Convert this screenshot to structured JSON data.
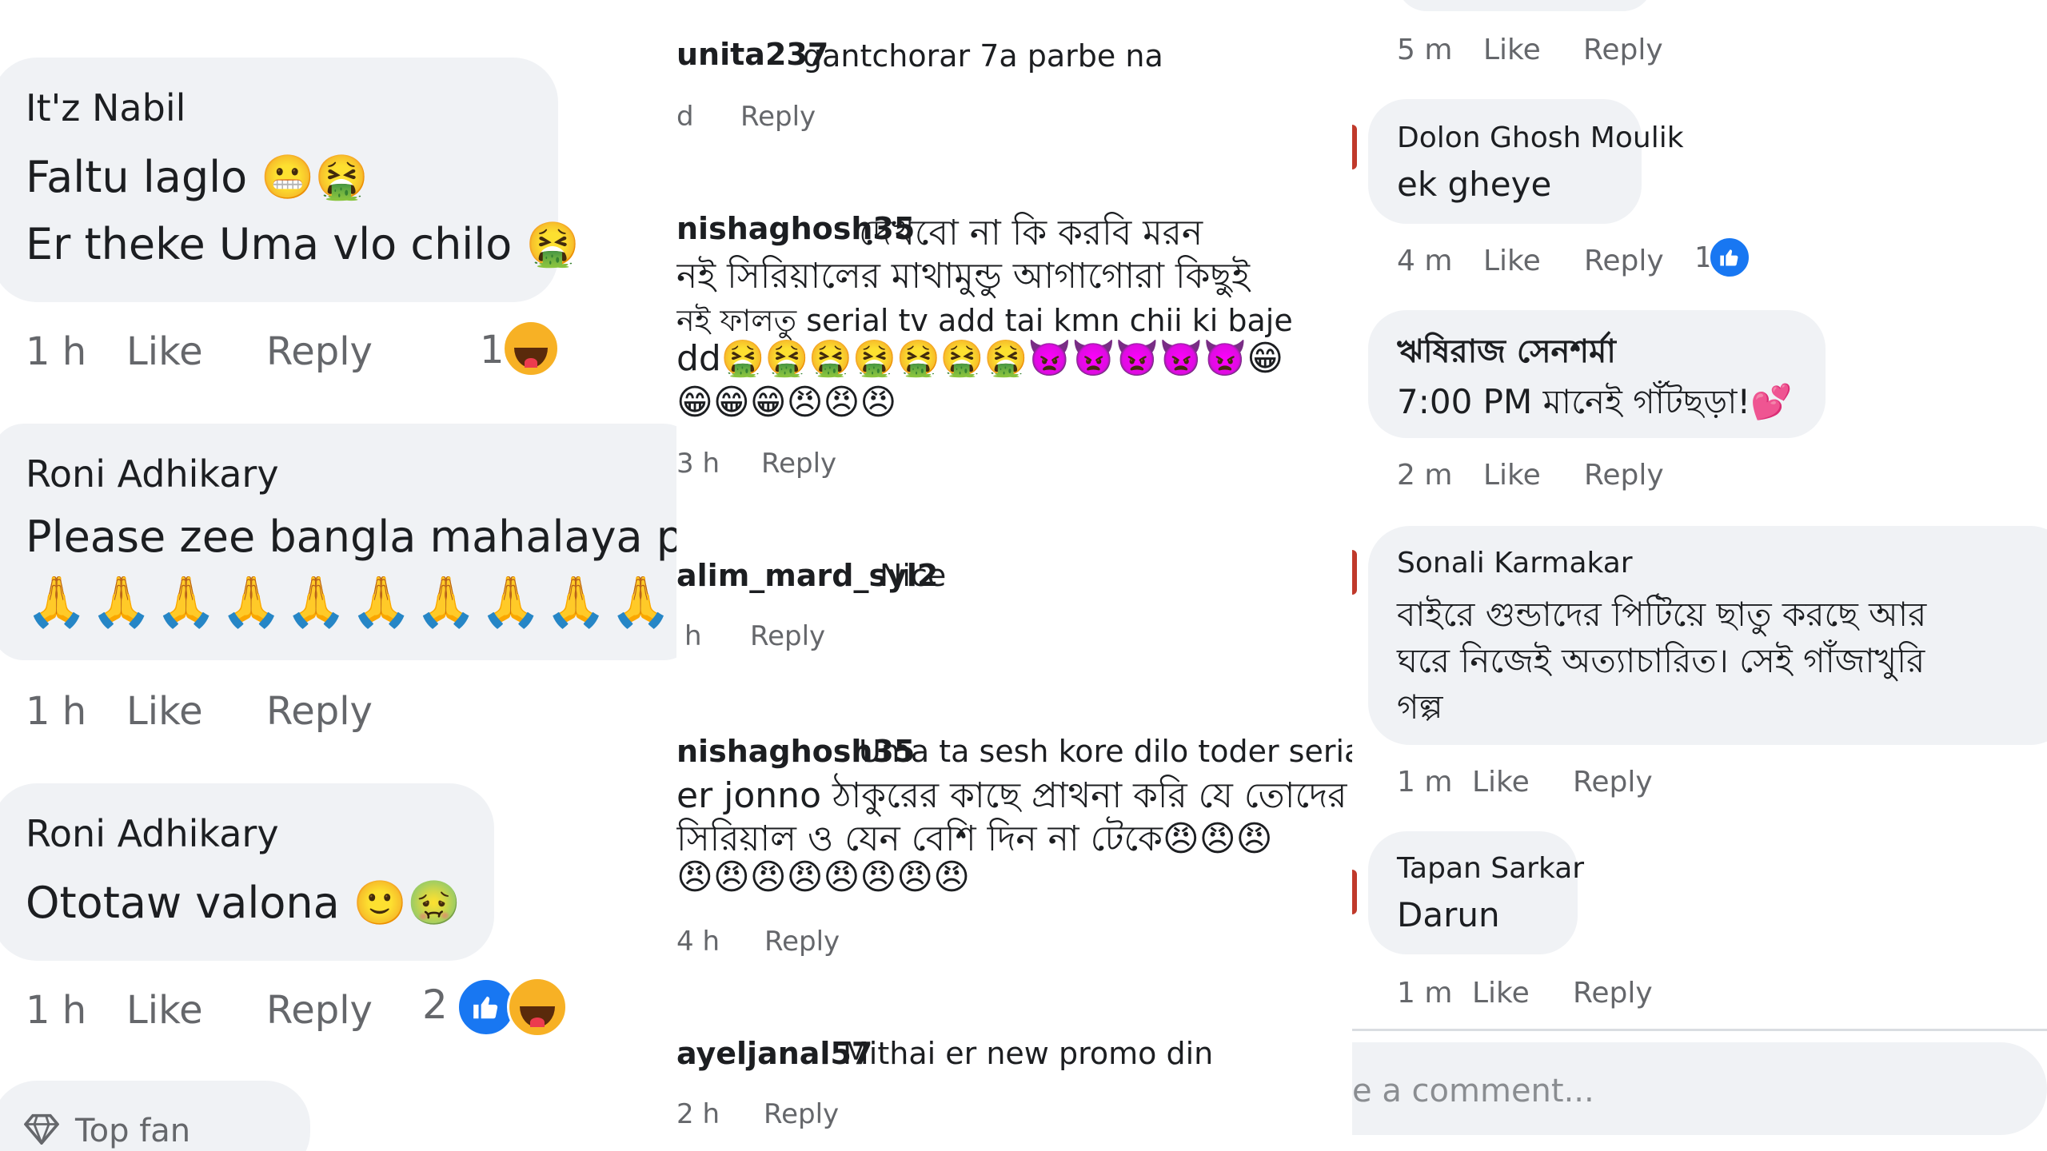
{
  "left": {
    "comments": [
      {
        "author": "It'z Nabil",
        "line1": "Faltu laglo 😬🤮",
        "line2": "Er theke Uma vlo chilo 🤮",
        "time": "1 h",
        "like": "Like",
        "reply": "Reply",
        "reaction_count": "1"
      },
      {
        "author": "Roni Adhikary",
        "line1": "Please zee bangla mahalaya promo",
        "line2": "🙏🙏🙏🙏🙏🙏🙏🙏🙏🙏",
        "time": "1 h",
        "like": "Like",
        "reply": "Reply"
      },
      {
        "author": "Roni Adhikary",
        "line1": "Ototaw valona 🙂🤢",
        "time": "1 h",
        "like": "Like",
        "reply": "Reply",
        "reaction_count": "2"
      }
    ],
    "top_fan": "Top fan"
  },
  "middle": {
    "comments": [
      {
        "author": "unita237",
        "text": "gantchorar 7a parbe na",
        "time": "d",
        "reply": "Reply"
      },
      {
        "author": "nishaghosh35",
        "line1": "দেখবো না কি করবি মরন",
        "line2": "নই সিরিয়ালের মাথামুন্ডু আগাগোরা কিছুই",
        "line3": "নই ফালতু serial tv add tai kmn chii ki baje",
        "line4": "dd🤮🤮🤮🤮🤮🤮🤮👿👿👿👿👿😁",
        "line5": "😁😁😁😠😠😠",
        "time": "3 h",
        "reply": "Reply"
      },
      {
        "author": "alim_mard_syl2",
        "text": "Nice",
        "time": "h",
        "reply": "Reply"
      },
      {
        "author": "nishaghosh35",
        "line1": "Uma ta sesh kore dilo toder serial",
        "line2": "er jonno ঠাকুরের কাছে প্রাথনা করি যে তোদের",
        "line3": "সিরিয়াল ও যেন বেশি দিন না টেকে😠😠😠",
        "line4": "😠😠😠😠😠😠😠😠",
        "time": "4 h",
        "reply": "Reply"
      },
      {
        "author": "ayeljanal57",
        "text": "Mithai er new promo din",
        "time": "2 h",
        "reply": "Reply"
      }
    ]
  },
  "right": {
    "top_meta": {
      "time": "5 m",
      "like": "Like",
      "reply": "Reply"
    },
    "comments": [
      {
        "author": "Dolon Ghosh Moulik",
        "text": "ek gheye",
        "time": "4 m",
        "like": "Like",
        "reply": "Reply",
        "reaction_count": "1"
      },
      {
        "author": "ঋষিরাজ সেনশর্মা",
        "text": "7:00 PM মানেই গাঁটছড়া!💕",
        "time": "2 m",
        "like": "Like",
        "reply": "Reply"
      },
      {
        "author": "Sonali Karmakar",
        "line1": "বাইরে গুন্ডাদের পিটিয়ে ছাতু করছে আর",
        "line2": "ঘরে নিজেই অত্যাচারিত। সেই গাঁজাখুরি",
        "line3": "গল্প",
        "time": "1 m",
        "like": "Like",
        "reply": "Reply"
      },
      {
        "author": "Tapan Sarkar",
        "text": "Darun",
        "time": "1 m",
        "like": "Like",
        "reply": "Reply"
      }
    ],
    "input_placeholder": "e a comment..."
  },
  "colors": {
    "bubble": "#f0f2f5",
    "meta": "#65676b",
    "like_blue": "#1877f2",
    "haha_yellow": "#f7b125"
  },
  "icons": [
    "like-reaction-icon",
    "haha-reaction-icon",
    "diamond-icon"
  ]
}
